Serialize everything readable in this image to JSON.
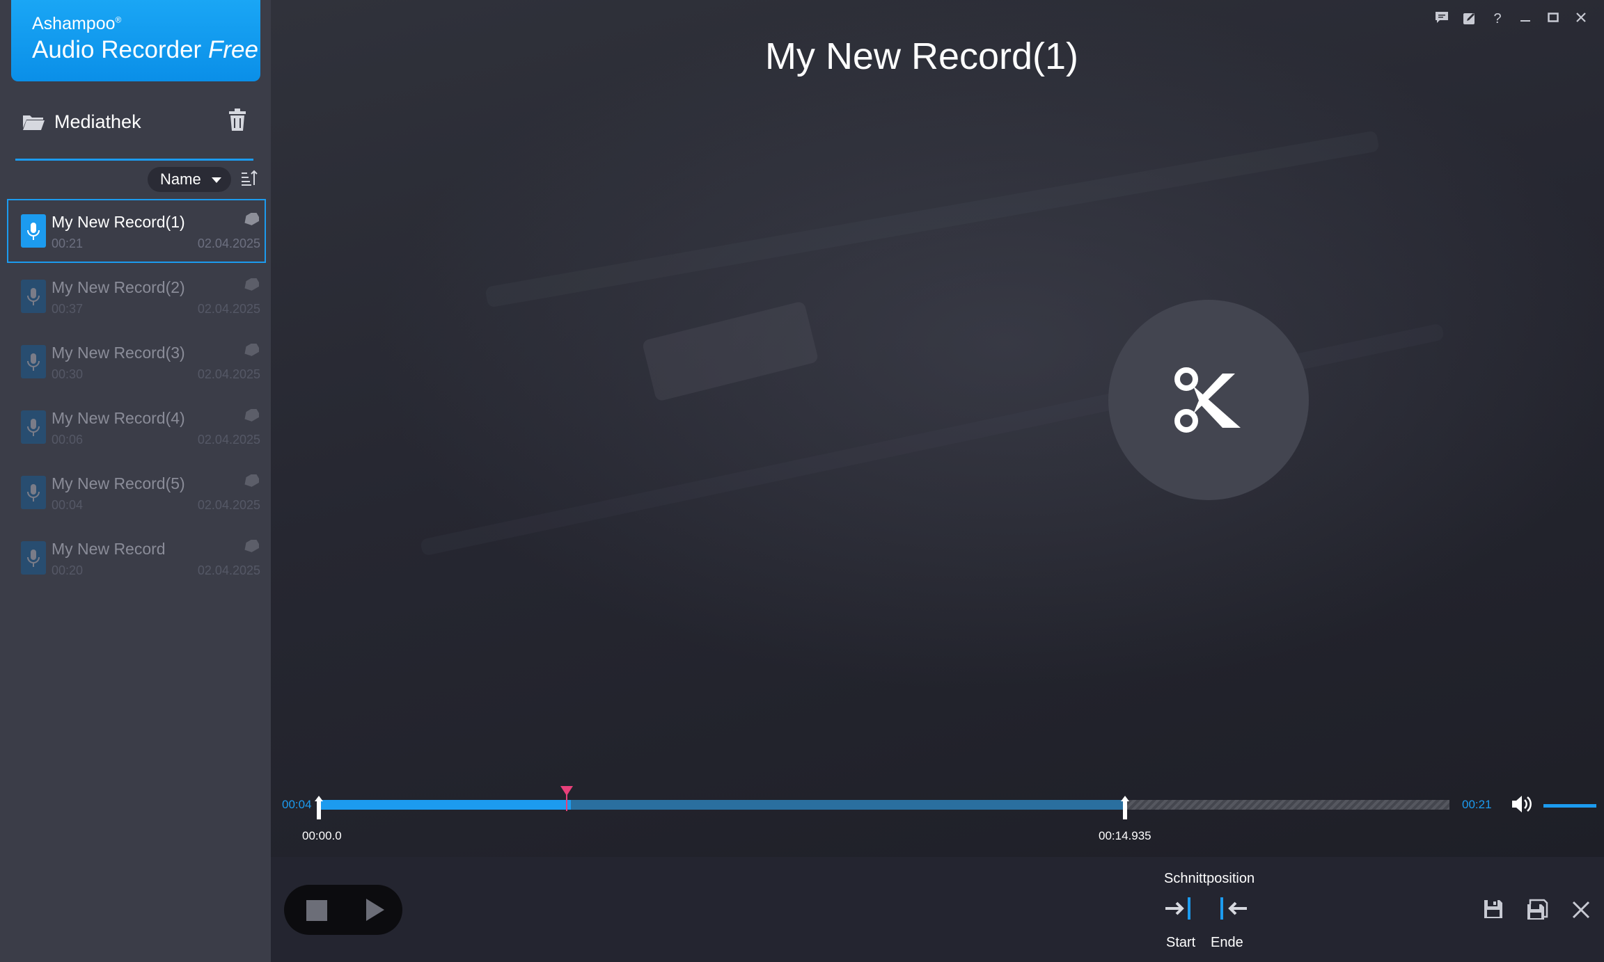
{
  "app": {
    "brand": "Ashampoo",
    "brand_mark": "®",
    "product": "Audio Recorder",
    "edition": "Free"
  },
  "library": {
    "title": "Mediathek",
    "sort_label": "Name",
    "records": [
      {
        "name": "My New Record(1)",
        "duration": "00:21",
        "date": "02.04.2025"
      },
      {
        "name": "My New Record(2)",
        "duration": "00:37",
        "date": "02.04.2025"
      },
      {
        "name": "My New Record(3)",
        "duration": "00:30",
        "date": "02.04.2025"
      },
      {
        "name": "My New Record(4)",
        "duration": "00:06",
        "date": "02.04.2025"
      },
      {
        "name": "My New Record(5)",
        "duration": "00:04",
        "date": "02.04.2025"
      },
      {
        "name": "My New Record",
        "duration": "00:20",
        "date": "02.04.2025"
      }
    ]
  },
  "editor": {
    "title": "My New Record(1)",
    "time_current": "00:04",
    "time_total": "00:21",
    "cut_start_label": "00:00.0",
    "cut_end_label": "00:14.935",
    "volume_level": 1.0
  },
  "bottom": {
    "cut_position_label": "Schnittposition",
    "start_label": "Start",
    "end_label": "Ende"
  },
  "colors": {
    "accent": "#1c9bef",
    "playhead": "#e8407a",
    "sidebar_bg": "#3b3d48",
    "main_bg": "#1f2029"
  },
  "icons": {
    "window_controls": [
      "feedback-icon",
      "edit-icon",
      "help-icon",
      "minimize-icon",
      "maximize-icon",
      "close-icon"
    ]
  }
}
